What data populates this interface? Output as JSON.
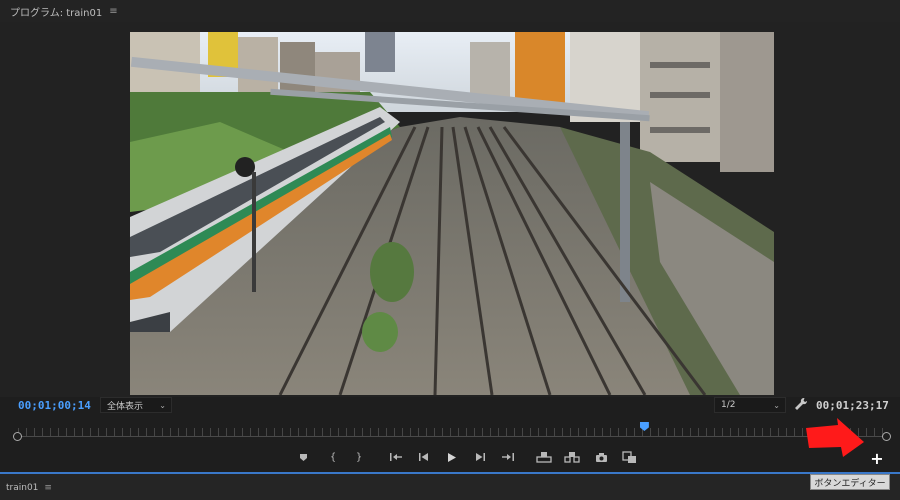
{
  "panel": {
    "title": "プログラム: train01",
    "menu_glyph": "≡"
  },
  "monitor": {
    "timecode_current": "00;01;00;14",
    "timecode_duration": "00;01;23;17",
    "zoom_label": "全体表示",
    "resolution_label": "1/2",
    "scrub_progress": 0.72
  },
  "transport": {
    "buttons": [
      {
        "name": "add-marker-icon"
      },
      {
        "name": "mark-in-icon",
        "glyph": "{"
      },
      {
        "name": "mark-out-icon",
        "glyph": "}"
      },
      {
        "name": "go-to-in-icon"
      },
      {
        "name": "step-back-icon"
      },
      {
        "name": "play-icon"
      },
      {
        "name": "step-forward-icon"
      },
      {
        "name": "go-to-out-icon"
      },
      {
        "name": "lift-icon"
      },
      {
        "name": "extract-icon"
      },
      {
        "name": "export-frame-icon"
      },
      {
        "name": "comparison-view-icon"
      }
    ],
    "plus_glyph": "+"
  },
  "bottom_panel": {
    "title": "train01",
    "menu_glyph": "≡"
  },
  "tooltip": {
    "text": "ボタンエディター"
  },
  "colors": {
    "accent": "#4a9fff",
    "annotation_arrow": "#ff1a1a",
    "divider": "#3a78c9"
  }
}
